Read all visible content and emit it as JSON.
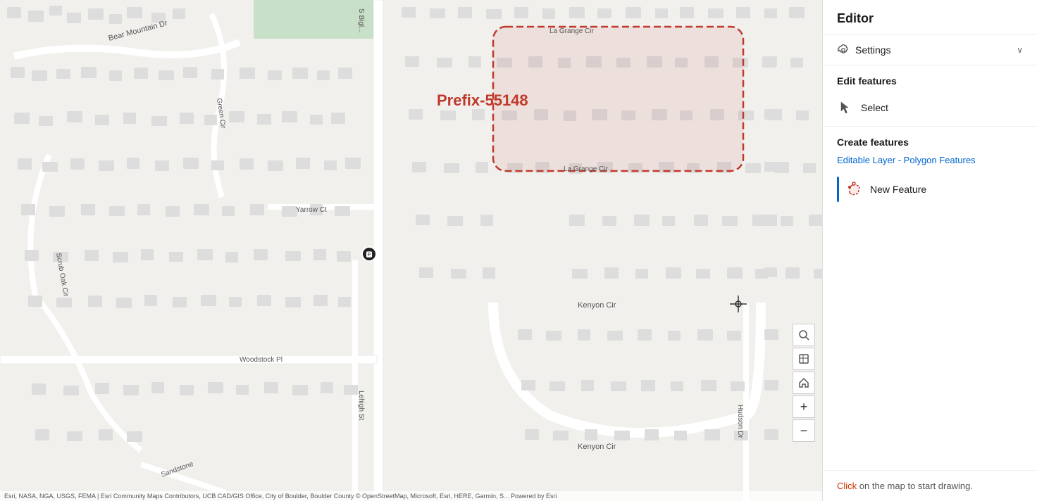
{
  "editor": {
    "title": "Editor",
    "settings": {
      "label": "Settings",
      "chevron": "∨"
    },
    "edit_features": {
      "section_title": "Edit features",
      "select_label": "Select"
    },
    "create_features": {
      "section_title": "Create features",
      "layer_label": "Editable Layer - Polygon Features",
      "new_feature_label": "New Feature"
    },
    "footer": {
      "text": "Click on the map to start drawing."
    }
  },
  "map": {
    "polygon_label": "Prefix-55148",
    "attribution": "Esri, NASA, NGA, USGS, FEMA | Esri Community Maps Contributors, UCB CAD/GIS Office, City of Boulder, Boulder County © OpenStreetMap, Microsoft, Esri, HERE, Garmin, S... Powered by Esri"
  },
  "tools": {
    "search": "🔍",
    "layers": "▦",
    "home": "⌂",
    "zoom_in": "+",
    "zoom_out": "−"
  }
}
